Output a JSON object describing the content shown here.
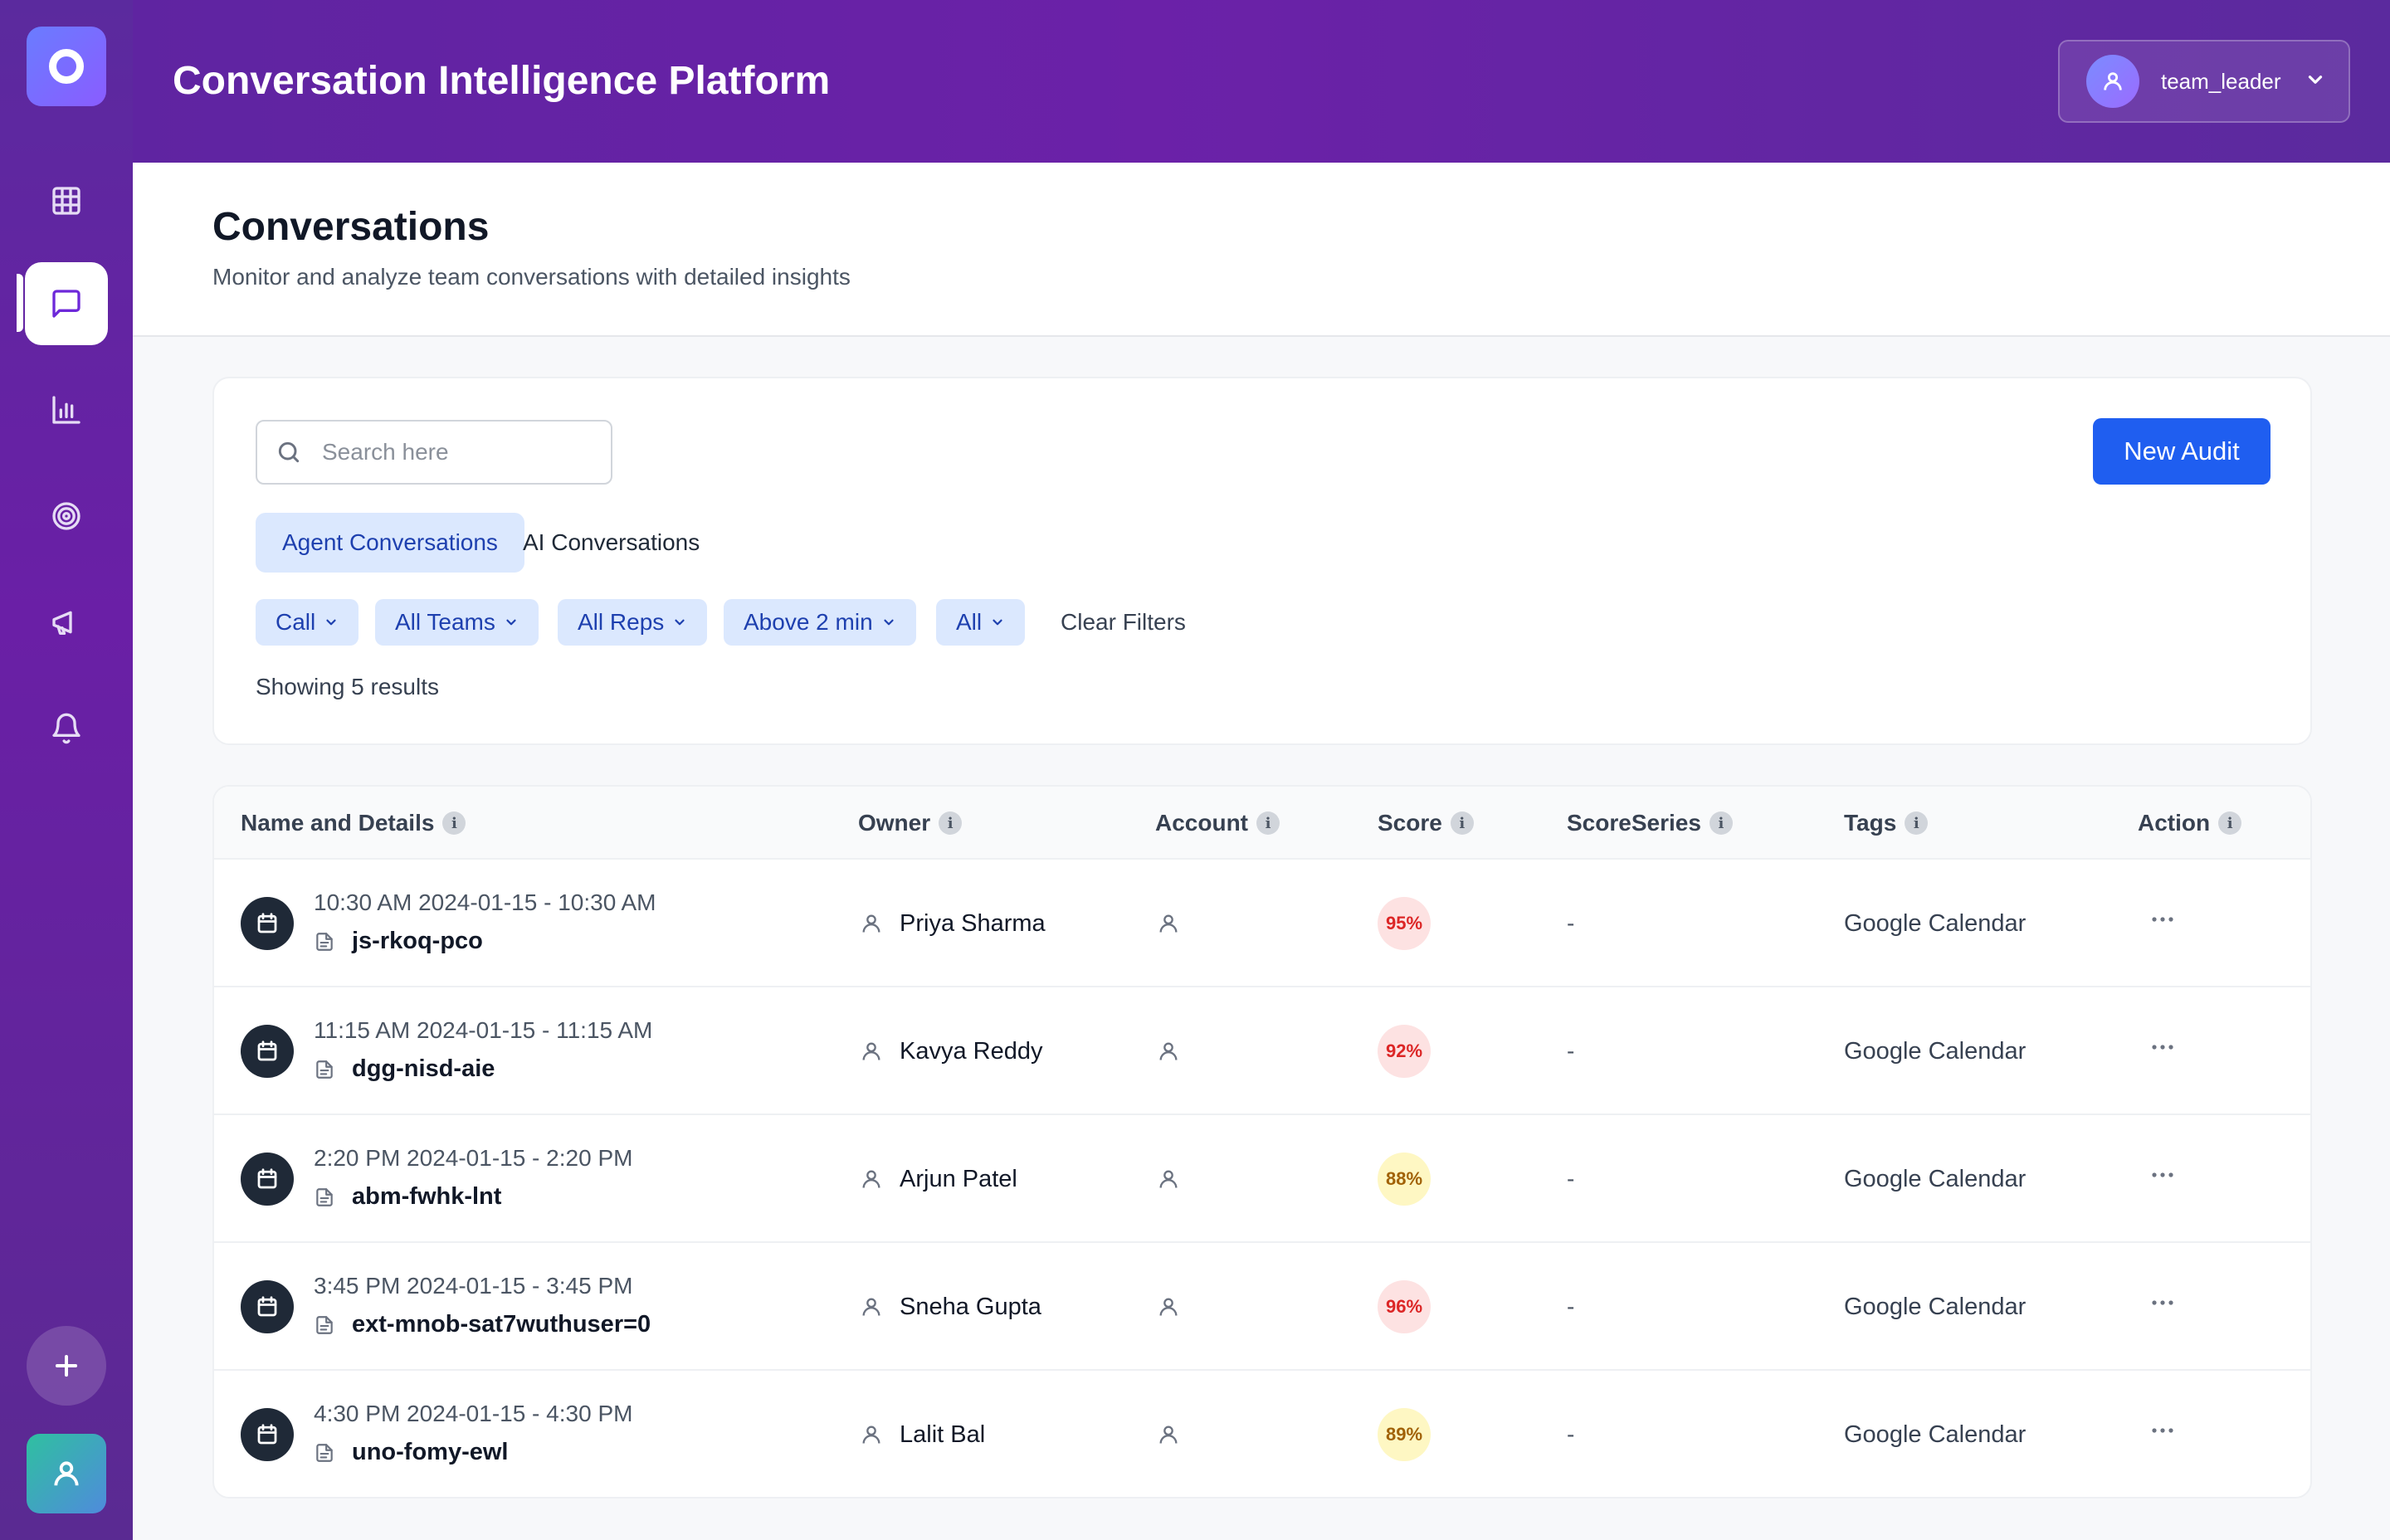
{
  "app": {
    "title": "Conversation Intelligence Platform",
    "user": "team_leader"
  },
  "sidebar": {
    "items": [
      "grid-icon",
      "chat-icon",
      "bar-chart-icon",
      "target-icon",
      "megaphone-icon",
      "bell-icon"
    ],
    "active": "chat-icon"
  },
  "page": {
    "title": "Conversations",
    "subtitle": "Monitor and analyze team conversations with detailed insights"
  },
  "search": {
    "placeholder": "Search here"
  },
  "toolbar": {
    "new_audit": "New Audit"
  },
  "tabs": [
    {
      "label": "Agent Conversations",
      "active": true
    },
    {
      "label": "AI Conversations",
      "active": false
    }
  ],
  "filters": {
    "chips": [
      "Call",
      "All Teams",
      "All Reps",
      "Above 2 min",
      "All"
    ],
    "clear_label": "Clear Filters",
    "result_text": "Showing 5 results"
  },
  "table": {
    "columns": [
      "Name and Details",
      "Owner",
      "Account",
      "Score",
      "ScoreSeries",
      "Tags",
      "Action"
    ],
    "rows": [
      {
        "time": "10:30 AM 2024-01-15 - 10:30 AM",
        "name": "js-rkoq-pco",
        "owner": "Priya Sharma",
        "score": "95%",
        "score_level": "red",
        "score_series": "-",
        "tags": "Google Calendar"
      },
      {
        "time": "11:15 AM 2024-01-15 - 11:15 AM",
        "name": "dgg-nisd-aie",
        "owner": "Kavya Reddy",
        "score": "92%",
        "score_level": "red",
        "score_series": "-",
        "tags": "Google Calendar"
      },
      {
        "time": "2:20 PM 2024-01-15 - 2:20 PM",
        "name": "abm-fwhk-lnt",
        "owner": "Arjun Patel",
        "score": "88%",
        "score_level": "yellow",
        "score_series": "-",
        "tags": "Google Calendar"
      },
      {
        "time": "3:45 PM 2024-01-15 - 3:45 PM",
        "name": "ext-mnob-sat7wuthuser=0",
        "owner": "Sneha Gupta",
        "score": "96%",
        "score_level": "red",
        "score_series": "-",
        "tags": "Google Calendar"
      },
      {
        "time": "4:30 PM 2024-01-15 - 4:30 PM",
        "name": "uno-fomy-ewl",
        "owner": "Lalit Bal",
        "score": "89%",
        "score_level": "yellow",
        "score_series": "-",
        "tags": "Google Calendar"
      }
    ]
  },
  "colors": {
    "brand_purple": "#6b21a8",
    "primary_blue": "#1f5ef0",
    "chip_bg": "#dbe8fe",
    "score_red": "#dc2626",
    "score_yellow": "#a16207"
  }
}
